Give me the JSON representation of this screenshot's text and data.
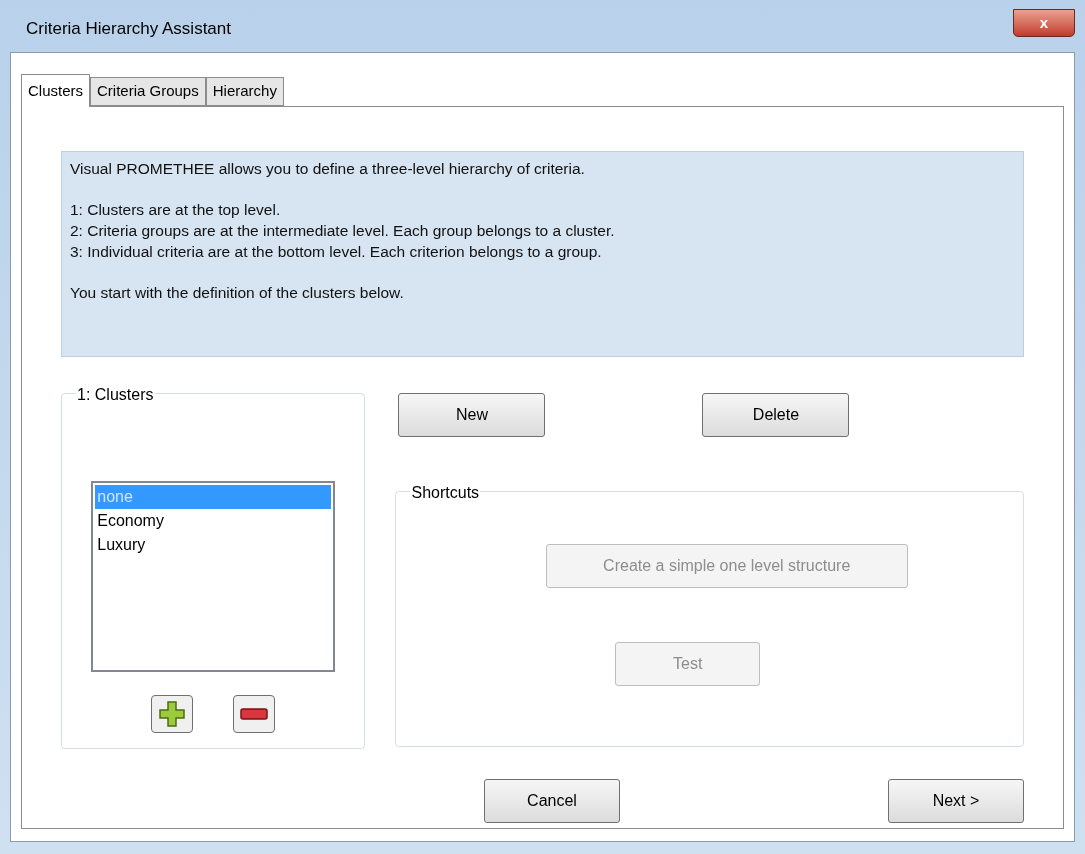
{
  "window": {
    "title": "Criteria Hierarchy Assistant",
    "close_label": "x"
  },
  "tabs": [
    {
      "label": "Clusters",
      "selected": true
    },
    {
      "label": "Criteria Groups",
      "selected": false
    },
    {
      "label": "Hierarchy",
      "selected": false
    }
  ],
  "intro": [
    "Visual PROMETHEE allows you to define a three-level hierarchy of criteria.",
    "1: Clusters are at the top level.\n2: Criteria groups are at the intermediate level. Each group belongs to a cluster.\n3: Individual criteria are at the bottom level. Each criterion belongs to a group.",
    "You start with the definition of the clusters below."
  ],
  "clusters": {
    "title": "1: Clusters",
    "items": [
      {
        "label": "none",
        "selected": true
      },
      {
        "label": "Economy",
        "selected": false
      },
      {
        "label": "Luxury",
        "selected": false
      }
    ]
  },
  "actions": [
    {
      "label": "New",
      "disabled": false
    },
    {
      "label": "Delete",
      "disabled": false
    }
  ],
  "shortcuts": {
    "title": "Shortcuts",
    "buttons": [
      {
        "label": "Create a simple one level structure",
        "disabled": true
      },
      {
        "label": "Test",
        "disabled": true
      }
    ]
  },
  "footer": [
    {
      "label": "Cancel",
      "disabled": false
    },
    {
      "label": "Next >",
      "disabled": false
    }
  ]
}
